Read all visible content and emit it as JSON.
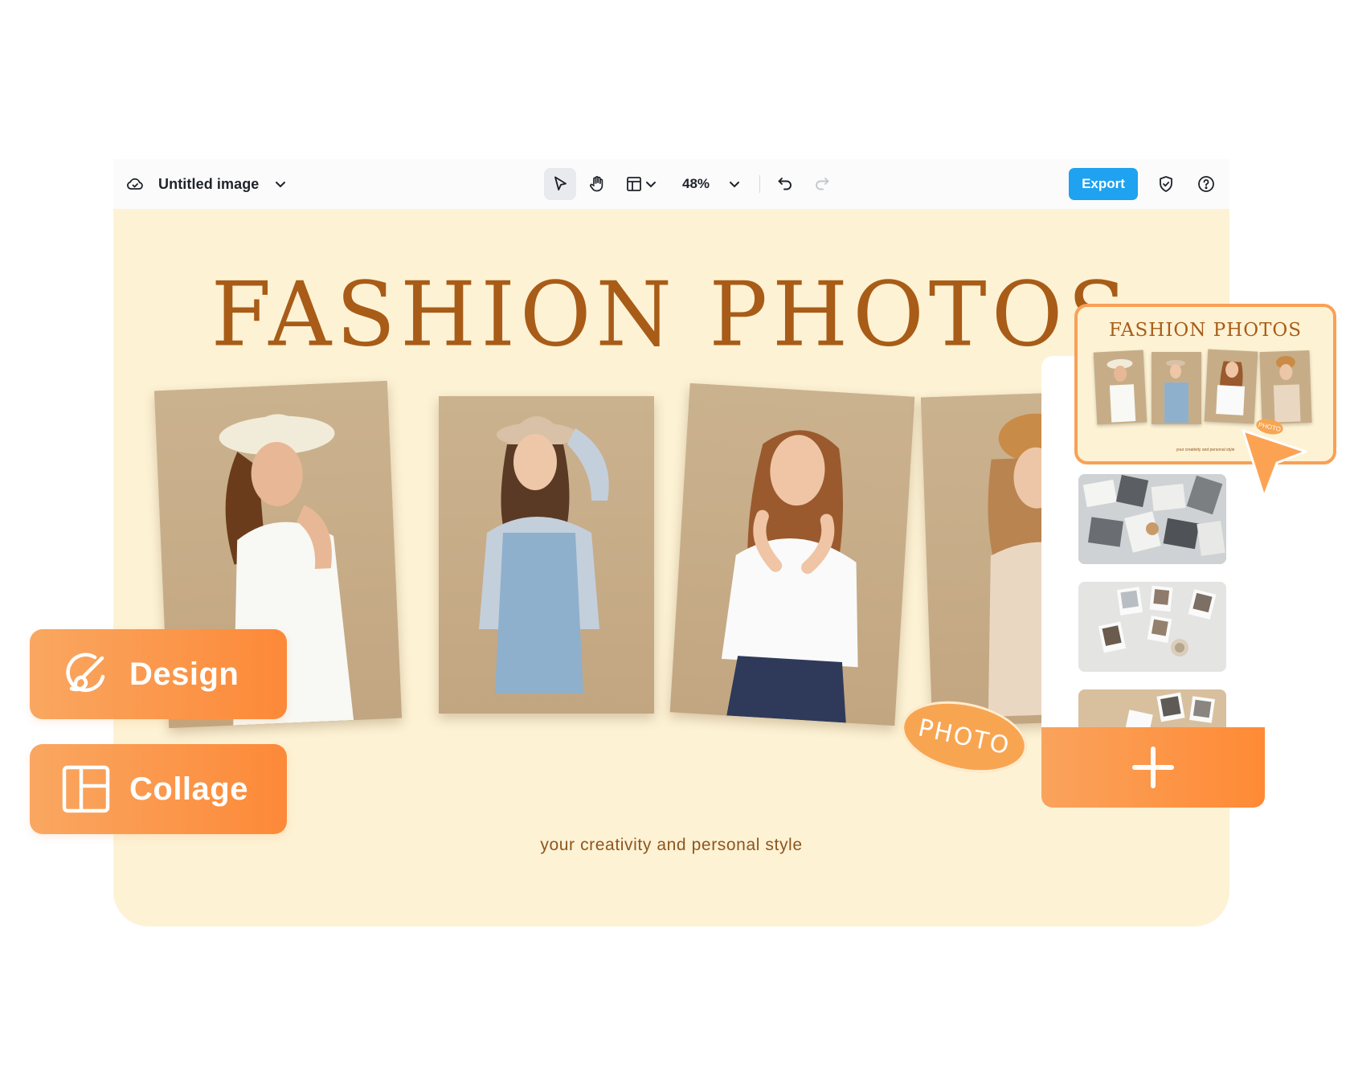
{
  "toolbar": {
    "document_title": "Untitled image",
    "zoom": "48%",
    "export_label": "Export"
  },
  "canvas": {
    "title": "FASHION PHOTOS",
    "subtitle": "your creativity and personal style",
    "stamp": "PHOTO"
  },
  "template_panel": {
    "featured_title": "FASHION PHOTOS",
    "featured_subtitle": "your creativity and personal style",
    "featured_stamp": "PHOTO"
  },
  "features": [
    {
      "label": "Design",
      "icon": "paint-brush-icon"
    },
    {
      "label": "Collage",
      "icon": "collage-layout-icon"
    }
  ],
  "colors": {
    "accent": "#fd8938",
    "export": "#1fa2ef",
    "canvas_bg": "#fdf2d4",
    "title": "#a85c17",
    "card": "#c6ad88"
  }
}
